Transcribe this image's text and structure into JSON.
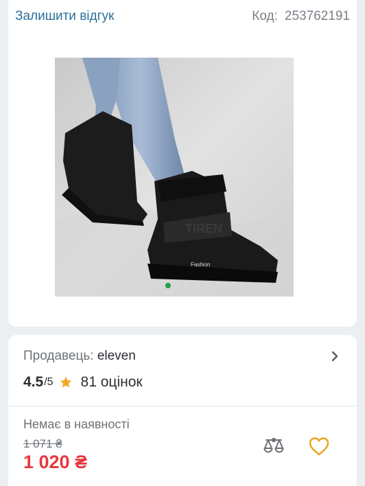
{
  "header": {
    "review_link": "Залишити відгук",
    "code_label": "Код:",
    "code_value": "253762191"
  },
  "gallery": {
    "image_text": "Fashion",
    "slides_total": 4,
    "active_slide": 1
  },
  "seller": {
    "label": "Продавець:",
    "name": "eleven"
  },
  "rating": {
    "value": "4.5",
    "max": "/5",
    "reviews": "81 оцінок"
  },
  "availability": "Немає в наявності",
  "price": {
    "old": "1 071 ₴",
    "current": "1 020 ₴"
  },
  "colors": {
    "accent_green": "#1fa14a",
    "price_red": "#e8383d",
    "star": "#f5a623",
    "heart": "#e8a317",
    "link": "#2a6f9a"
  },
  "icons": [
    "chevron-right-icon",
    "star-icon",
    "compare-scales-icon",
    "heart-icon"
  ]
}
